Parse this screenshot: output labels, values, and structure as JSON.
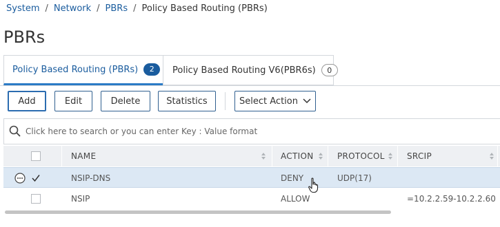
{
  "breadcrumb": {
    "items": [
      "System",
      "Network",
      "PBRs"
    ],
    "current": "Policy Based Routing (PBRs)",
    "separator": "/"
  },
  "page": {
    "title": "PBRs"
  },
  "tabs": [
    {
      "label": "Policy Based Routing (PBRs)",
      "count": "2",
      "active": true
    },
    {
      "label": "Policy Based Routing V6(PBR6s)",
      "count": "0",
      "active": false
    }
  ],
  "toolbar": {
    "add": "Add",
    "edit": "Edit",
    "delete": "Delete",
    "statistics": "Statistics",
    "select_action": "Select Action"
  },
  "search": {
    "placeholder": "Click here to search or you can enter Key : Value format"
  },
  "table": {
    "columns": [
      "NAME",
      "ACTION",
      "PROTOCOL",
      "SRCIP"
    ],
    "rows": [
      {
        "name": "NSIP-DNS",
        "action": "DENY",
        "protocol": "UDP(17)",
        "srcip": "",
        "checked": true,
        "selected": true
      },
      {
        "name": "NSIP",
        "action": "ALLOW",
        "protocol": "",
        "srcip": "=10.2.2.59-10.2.2.60",
        "checked": false,
        "selected": false
      }
    ]
  },
  "colors": {
    "accent": "#1a5c9e",
    "selected_row": "#dce8f4",
    "header_bg": "#eef0f3",
    "border": "#d3d7dc"
  }
}
